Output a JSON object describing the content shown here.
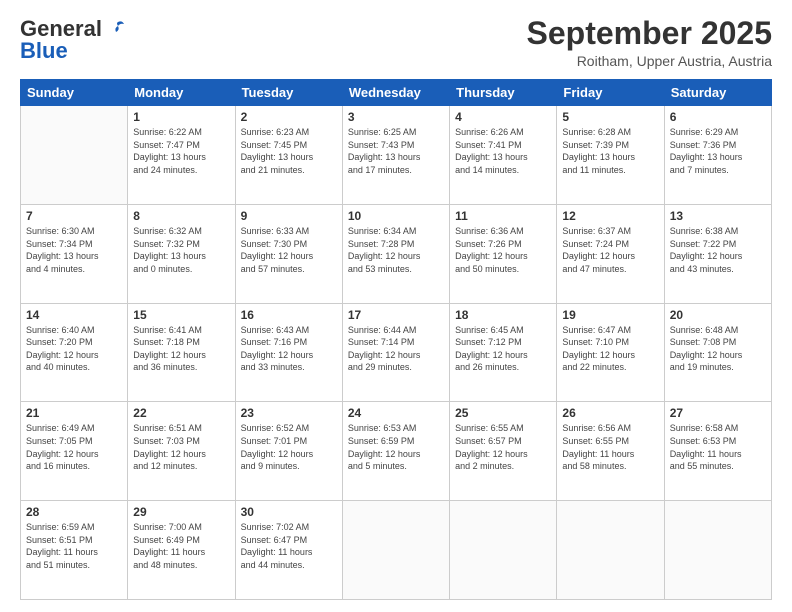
{
  "logo": {
    "line1": "General",
    "line2": "Blue"
  },
  "header": {
    "month": "September 2025",
    "location": "Roitham, Upper Austria, Austria"
  },
  "weekdays": [
    "Sunday",
    "Monday",
    "Tuesday",
    "Wednesday",
    "Thursday",
    "Friday",
    "Saturday"
  ],
  "weeks": [
    [
      {
        "day": "",
        "info": ""
      },
      {
        "day": "1",
        "info": "Sunrise: 6:22 AM\nSunset: 7:47 PM\nDaylight: 13 hours\nand 24 minutes."
      },
      {
        "day": "2",
        "info": "Sunrise: 6:23 AM\nSunset: 7:45 PM\nDaylight: 13 hours\nand 21 minutes."
      },
      {
        "day": "3",
        "info": "Sunrise: 6:25 AM\nSunset: 7:43 PM\nDaylight: 13 hours\nand 17 minutes."
      },
      {
        "day": "4",
        "info": "Sunrise: 6:26 AM\nSunset: 7:41 PM\nDaylight: 13 hours\nand 14 minutes."
      },
      {
        "day": "5",
        "info": "Sunrise: 6:28 AM\nSunset: 7:39 PM\nDaylight: 13 hours\nand 11 minutes."
      },
      {
        "day": "6",
        "info": "Sunrise: 6:29 AM\nSunset: 7:36 PM\nDaylight: 13 hours\nand 7 minutes."
      }
    ],
    [
      {
        "day": "7",
        "info": "Sunrise: 6:30 AM\nSunset: 7:34 PM\nDaylight: 13 hours\nand 4 minutes."
      },
      {
        "day": "8",
        "info": "Sunrise: 6:32 AM\nSunset: 7:32 PM\nDaylight: 13 hours\nand 0 minutes."
      },
      {
        "day": "9",
        "info": "Sunrise: 6:33 AM\nSunset: 7:30 PM\nDaylight: 12 hours\nand 57 minutes."
      },
      {
        "day": "10",
        "info": "Sunrise: 6:34 AM\nSunset: 7:28 PM\nDaylight: 12 hours\nand 53 minutes."
      },
      {
        "day": "11",
        "info": "Sunrise: 6:36 AM\nSunset: 7:26 PM\nDaylight: 12 hours\nand 50 minutes."
      },
      {
        "day": "12",
        "info": "Sunrise: 6:37 AM\nSunset: 7:24 PM\nDaylight: 12 hours\nand 47 minutes."
      },
      {
        "day": "13",
        "info": "Sunrise: 6:38 AM\nSunset: 7:22 PM\nDaylight: 12 hours\nand 43 minutes."
      }
    ],
    [
      {
        "day": "14",
        "info": "Sunrise: 6:40 AM\nSunset: 7:20 PM\nDaylight: 12 hours\nand 40 minutes."
      },
      {
        "day": "15",
        "info": "Sunrise: 6:41 AM\nSunset: 7:18 PM\nDaylight: 12 hours\nand 36 minutes."
      },
      {
        "day": "16",
        "info": "Sunrise: 6:43 AM\nSunset: 7:16 PM\nDaylight: 12 hours\nand 33 minutes."
      },
      {
        "day": "17",
        "info": "Sunrise: 6:44 AM\nSunset: 7:14 PM\nDaylight: 12 hours\nand 29 minutes."
      },
      {
        "day": "18",
        "info": "Sunrise: 6:45 AM\nSunset: 7:12 PM\nDaylight: 12 hours\nand 26 minutes."
      },
      {
        "day": "19",
        "info": "Sunrise: 6:47 AM\nSunset: 7:10 PM\nDaylight: 12 hours\nand 22 minutes."
      },
      {
        "day": "20",
        "info": "Sunrise: 6:48 AM\nSunset: 7:08 PM\nDaylight: 12 hours\nand 19 minutes."
      }
    ],
    [
      {
        "day": "21",
        "info": "Sunrise: 6:49 AM\nSunset: 7:05 PM\nDaylight: 12 hours\nand 16 minutes."
      },
      {
        "day": "22",
        "info": "Sunrise: 6:51 AM\nSunset: 7:03 PM\nDaylight: 12 hours\nand 12 minutes."
      },
      {
        "day": "23",
        "info": "Sunrise: 6:52 AM\nSunset: 7:01 PM\nDaylight: 12 hours\nand 9 minutes."
      },
      {
        "day": "24",
        "info": "Sunrise: 6:53 AM\nSunset: 6:59 PM\nDaylight: 12 hours\nand 5 minutes."
      },
      {
        "day": "25",
        "info": "Sunrise: 6:55 AM\nSunset: 6:57 PM\nDaylight: 12 hours\nand 2 minutes."
      },
      {
        "day": "26",
        "info": "Sunrise: 6:56 AM\nSunset: 6:55 PM\nDaylight: 11 hours\nand 58 minutes."
      },
      {
        "day": "27",
        "info": "Sunrise: 6:58 AM\nSunset: 6:53 PM\nDaylight: 11 hours\nand 55 minutes."
      }
    ],
    [
      {
        "day": "28",
        "info": "Sunrise: 6:59 AM\nSunset: 6:51 PM\nDaylight: 11 hours\nand 51 minutes."
      },
      {
        "day": "29",
        "info": "Sunrise: 7:00 AM\nSunset: 6:49 PM\nDaylight: 11 hours\nand 48 minutes."
      },
      {
        "day": "30",
        "info": "Sunrise: 7:02 AM\nSunset: 6:47 PM\nDaylight: 11 hours\nand 44 minutes."
      },
      {
        "day": "",
        "info": ""
      },
      {
        "day": "",
        "info": ""
      },
      {
        "day": "",
        "info": ""
      },
      {
        "day": "",
        "info": ""
      }
    ]
  ]
}
